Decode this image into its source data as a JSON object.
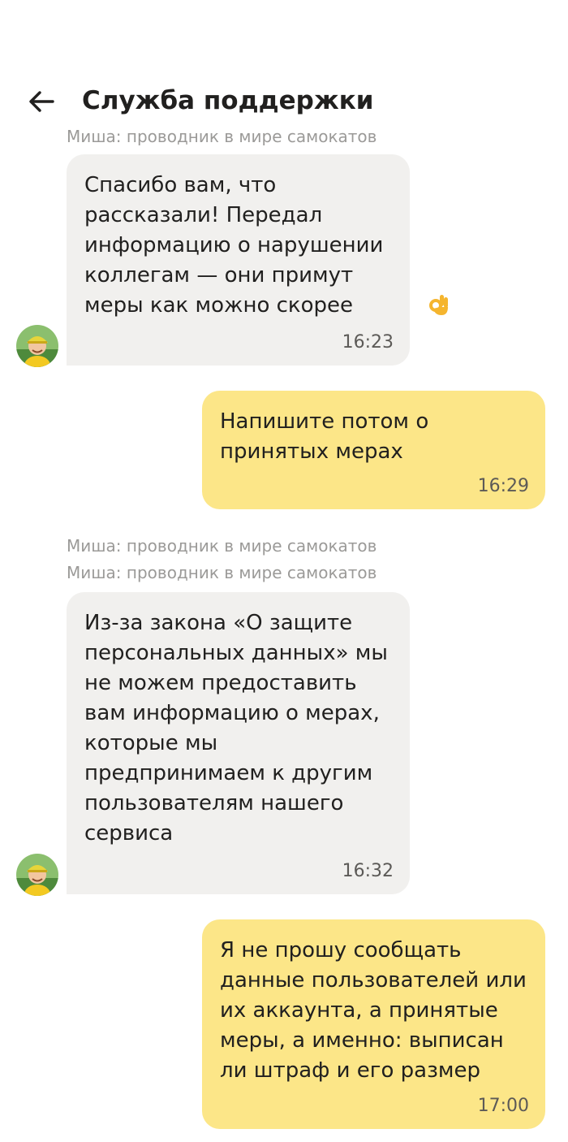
{
  "header": {
    "title": "Служба поддержки",
    "back_icon": "arrow-left-icon"
  },
  "agent": {
    "name": "Миша: проводник в мире самокатов",
    "avatar_icon": "avatar-child-helmet"
  },
  "messages": [
    {
      "side": "in",
      "text": "Спасибо вам, что\nрассказали! Передал\nинформацию о нарушении\nколлегам — они примут\nмеры как можно скорее",
      "emoji": "ok-hand-icon",
      "time": "16:23"
    },
    {
      "side": "out",
      "text": "Напишите потом о\nпринятых мерах",
      "time": "16:29"
    },
    {
      "side": "in",
      "text": "Из-за закона «О защите\nперсональных данных» мы\nне можем предоставить\nвам информацию о мерах,\nкоторые мы\nпредпринимаем к другим\nпользователям нашего\nсервиса",
      "time": "16:32"
    },
    {
      "side": "out",
      "text": "Я не прошу сообщать\nданные пользователей или\nих аккаунта, а принятые\nмеры, а именно: выписан\nли штраф и его размер",
      "time": "17:00"
    }
  ],
  "colors": {
    "incoming_bubble": "#f1f0ee",
    "outgoing_bubble": "#fce688",
    "sender_label": "#9b9a98"
  }
}
